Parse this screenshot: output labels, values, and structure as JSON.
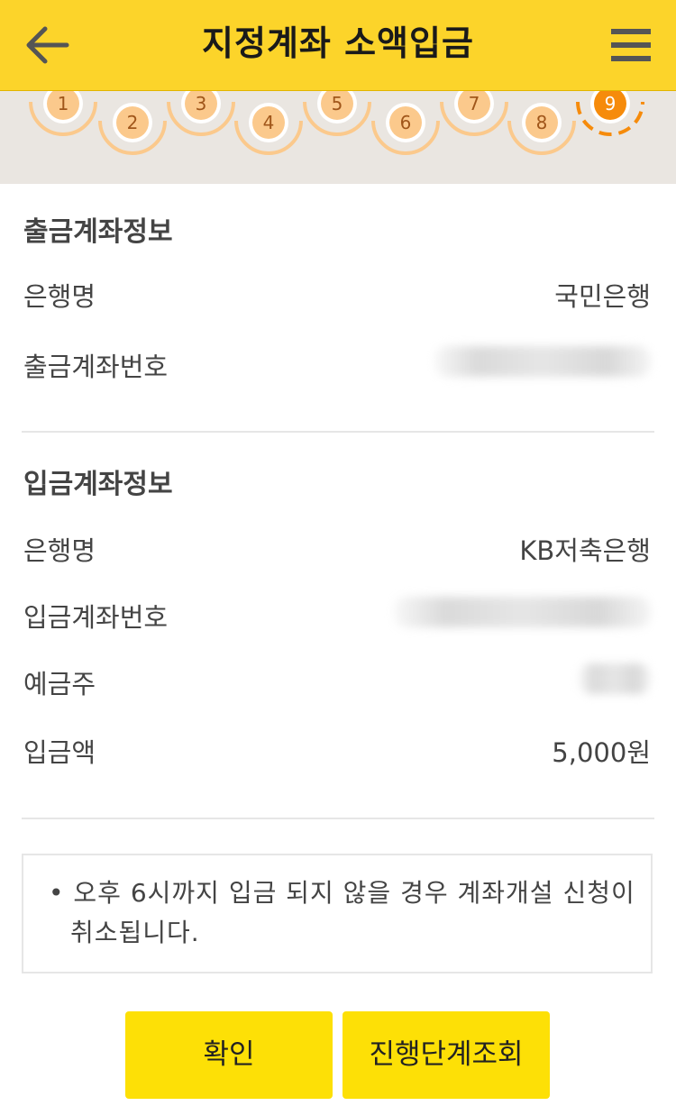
{
  "header": {
    "title": "지정계좌 소액입금",
    "back_icon": "arrow-left-icon",
    "menu_icon": "hamburger-menu-icon",
    "background_color": "#fcd42a"
  },
  "steps": {
    "labels": [
      "1",
      "2",
      "3",
      "4",
      "5",
      "6",
      "7",
      "8",
      "9"
    ],
    "current": "9",
    "done_color": "#fbc98c",
    "current_color": "#f68b0b"
  },
  "withdraw_account": {
    "title": "출금계좌정보",
    "bank_label": "은행명",
    "bank_value": "국민은행",
    "account_label": "출금계좌번호"
  },
  "deposit_account": {
    "title": "입금계좌정보",
    "bank_label": "은행명",
    "bank_value": "KB저축은행",
    "account_label": "입금계좌번호",
    "holder_label": "예금주",
    "amount_label": "입금액",
    "amount_value": "5,000원"
  },
  "notice": {
    "text": "• 오후 6시까지 입금 되지 않을 경우 계좌개설 신청이 취소됩니다."
  },
  "buttons": {
    "confirm_label": "확인",
    "progress_label": "진행단계조회",
    "color": "#fde006"
  }
}
